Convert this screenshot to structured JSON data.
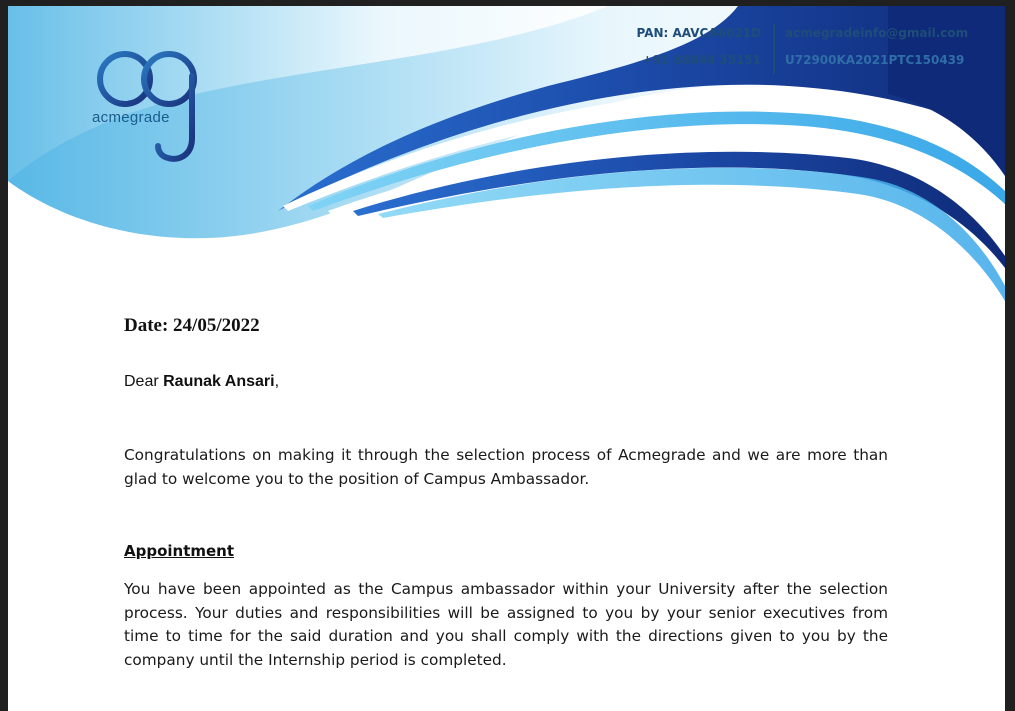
{
  "header": {
    "logo_text": "acmegrade",
    "pan": "PAN: AAVCA6021D",
    "phone": "+91 88844 35151",
    "email": "acmegradeinfo@gmail.com",
    "cin": "U72900KA2021PTC150439",
    "colors": {
      "brand_dark": "#1a3d8f",
      "brand_light": "#62c3ee",
      "text_blue": "#1f4d7a"
    }
  },
  "letter": {
    "date": "Date: 24/05/2022",
    "salutation": "Dear ",
    "recipient": "Raunak Ansari",
    "salutation_end": ",",
    "intro": "Congratulations on making it through the selection process of Acmegrade and we are more than glad to welcome you to the position of Campus Ambassador.",
    "section_heading": "Appointment",
    "appointment_text": "You have been appointed as the Campus ambassador within your University after the selection process. Your duties and responsibilities will be assigned to you by your senior executives from time to time for the said duration and you shall comply with the directions given to you by the company until the Internship period is completed."
  }
}
